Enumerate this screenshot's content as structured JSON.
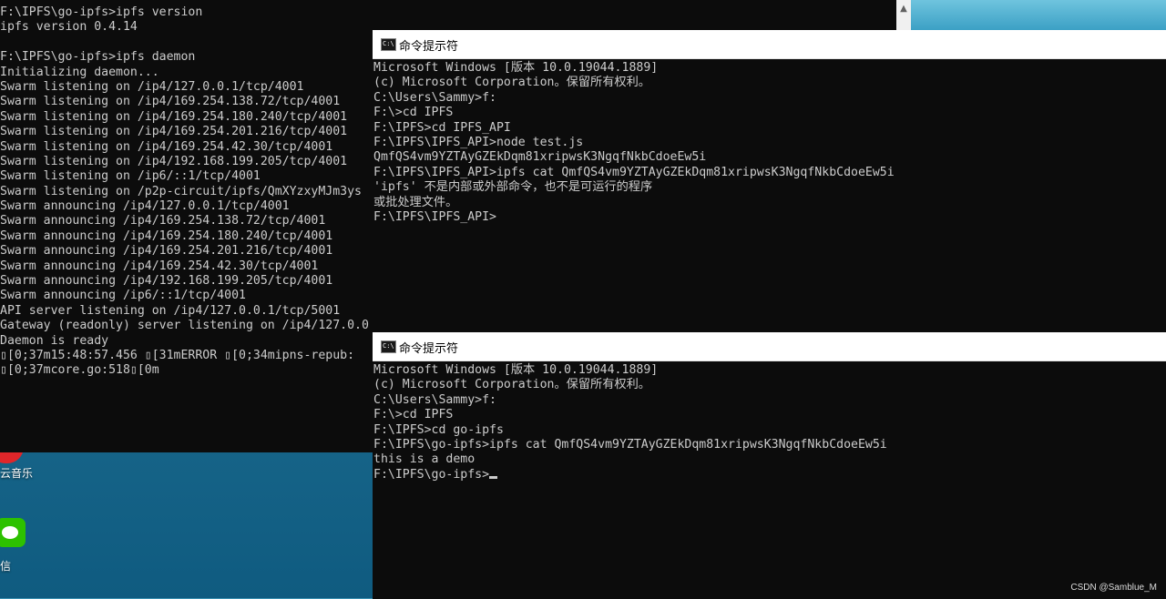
{
  "desktop": {
    "icon1_label": "云音乐",
    "icon2_label": "信"
  },
  "left_terminal": {
    "lines": [
      "F:\\IPFS\\go-ipfs>ipfs version",
      "ipfs version 0.4.14",
      "",
      "F:\\IPFS\\go-ipfs>ipfs daemon",
      "Initializing daemon...",
      "Swarm listening on /ip4/127.0.0.1/tcp/4001",
      "Swarm listening on /ip4/169.254.138.72/tcp/4001",
      "Swarm listening on /ip4/169.254.180.240/tcp/4001",
      "Swarm listening on /ip4/169.254.201.216/tcp/4001",
      "Swarm listening on /ip4/169.254.42.30/tcp/4001",
      "Swarm listening on /ip4/192.168.199.205/tcp/4001",
      "Swarm listening on /ip6/::1/tcp/4001",
      "Swarm listening on /p2p-circuit/ipfs/QmXYzxyMJm3ys",
      "Swarm announcing /ip4/127.0.0.1/tcp/4001",
      "Swarm announcing /ip4/169.254.138.72/tcp/4001",
      "Swarm announcing /ip4/169.254.180.240/tcp/4001",
      "Swarm announcing /ip4/169.254.201.216/tcp/4001",
      "Swarm announcing /ip4/169.254.42.30/tcp/4001",
      "Swarm announcing /ip4/192.168.199.205/tcp/4001",
      "Swarm announcing /ip6/::1/tcp/4001",
      "API server listening on /ip4/127.0.0.1/tcp/5001",
      "Gateway (readonly) server listening on /ip4/127.0.0",
      "Daemon is ready",
      "▯[0;37m15:48:57.456 ▯[31mERROR ▯[0;34mipns-repub:",
      "▯[0;37mcore.go:518▯[0m"
    ]
  },
  "cmd_window_1": {
    "title": "命令提示符",
    "icon_text": "C:\\",
    "lines": [
      "Microsoft Windows [版本 10.0.19044.1889]",
      "(c) Microsoft Corporation。保留所有权利。",
      "",
      "C:\\Users\\Sammy>f:",
      "",
      "F:\\>cd IPFS",
      "",
      "F:\\IPFS>cd IPFS_API",
      "",
      "F:\\IPFS\\IPFS_API>node test.js",
      "QmfQS4vm9YZTAyGZEkDqm81xripwsK3NgqfNkbCdoeEw5i",
      "",
      "F:\\IPFS\\IPFS_API>ipfs cat QmfQS4vm9YZTAyGZEkDqm81xripwsK3NgqfNkbCdoeEw5i",
      "'ipfs' 不是内部或外部命令，也不是可运行的程序",
      "或批处理文件。",
      "",
      "F:\\IPFS\\IPFS_API>"
    ]
  },
  "cmd_window_2": {
    "title": "命令提示符",
    "icon_text": "C:\\",
    "lines": [
      "Microsoft Windows [版本 10.0.19044.1889]",
      "(c) Microsoft Corporation。保留所有权利。",
      "",
      "C:\\Users\\Sammy>f:",
      "",
      "F:\\>cd IPFS",
      "",
      "F:\\IPFS>cd go-ipfs",
      "",
      "F:\\IPFS\\go-ipfs>ipfs cat QmfQS4vm9YZTAyGZEkDqm81xripwsK3NgqfNkbCdoeEw5i",
      "this is a demo"
    ],
    "prompt": "F:\\IPFS\\go-ipfs>"
  },
  "watermark": "CSDN @Samblue_M",
  "colors": {
    "terminal_bg": "#0c0c0c",
    "terminal_fg": "#cccccc",
    "titlebar_bg": "#ffffff"
  }
}
